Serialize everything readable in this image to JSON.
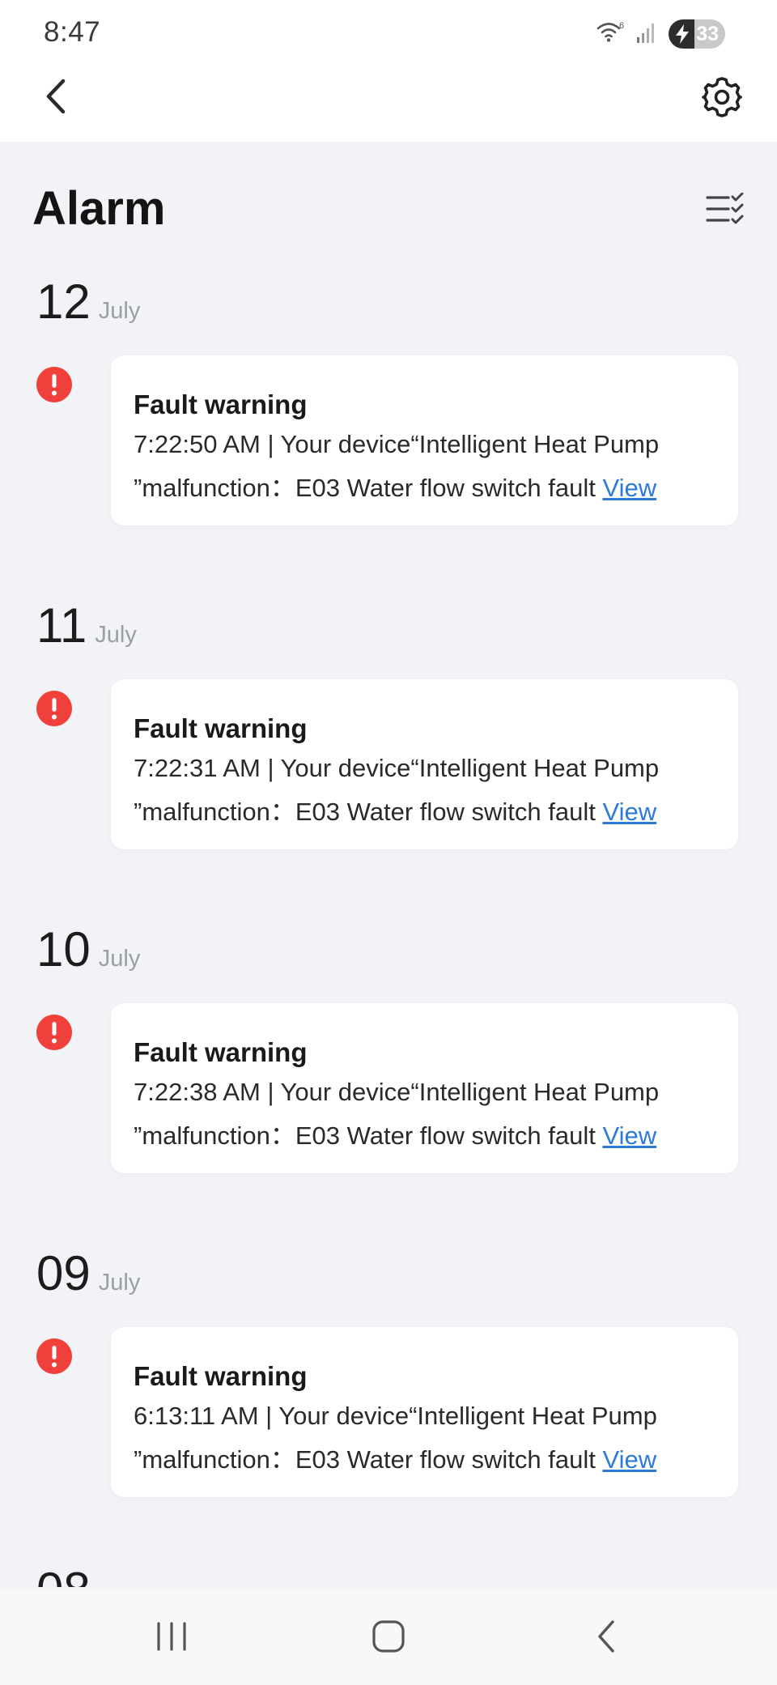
{
  "status_bar": {
    "time": "8:47",
    "wifi_icon": "wifi-6-icon",
    "signal_icon": "cellular-signal-icon",
    "battery_level": "33",
    "battery_charging": true
  },
  "header": {
    "back_icon": "chevron-left-icon",
    "settings_icon": "gear-icon"
  },
  "page": {
    "title": "Alarm",
    "mark_all_read_icon": "list-check-icon"
  },
  "groups": [
    {
      "day": "12",
      "month": "July",
      "alarms": [
        {
          "title": "Fault warning",
          "line1": "7:22:50 AM | Your device“Intelligent Heat Pump",
          "line2": "”malfunction：E03 Water flow switch fault",
          "link": "View"
        }
      ]
    },
    {
      "day": "11",
      "month": "July",
      "alarms": [
        {
          "title": "Fault warning",
          "line1": "7:22:31 AM | Your device“Intelligent Heat Pump",
          "line2": "”malfunction：E03 Water flow switch fault",
          "link": "View"
        }
      ]
    },
    {
      "day": "10",
      "month": "July",
      "alarms": [
        {
          "title": "Fault warning",
          "line1": "7:22:38 AM | Your device“Intelligent Heat Pump",
          "line2": "”malfunction：E03 Water flow switch fault",
          "link": "View"
        }
      ]
    },
    {
      "day": "09",
      "month": "July",
      "alarms": [
        {
          "title": "Fault warning",
          "line1": "6:13:11 AM | Your device“Intelligent Heat Pump",
          "line2": "”malfunction：E03 Water flow switch fault",
          "link": "View"
        }
      ]
    }
  ],
  "partial_group": {
    "day": "08"
  },
  "colors": {
    "alert_red": "#f0403c",
    "link_blue": "#2d7bd8",
    "page_background": "#f2f3f7"
  },
  "nav_bar": {
    "recents_icon": "recents-icon",
    "home_icon": "home-icon",
    "back_icon": "back-icon"
  }
}
